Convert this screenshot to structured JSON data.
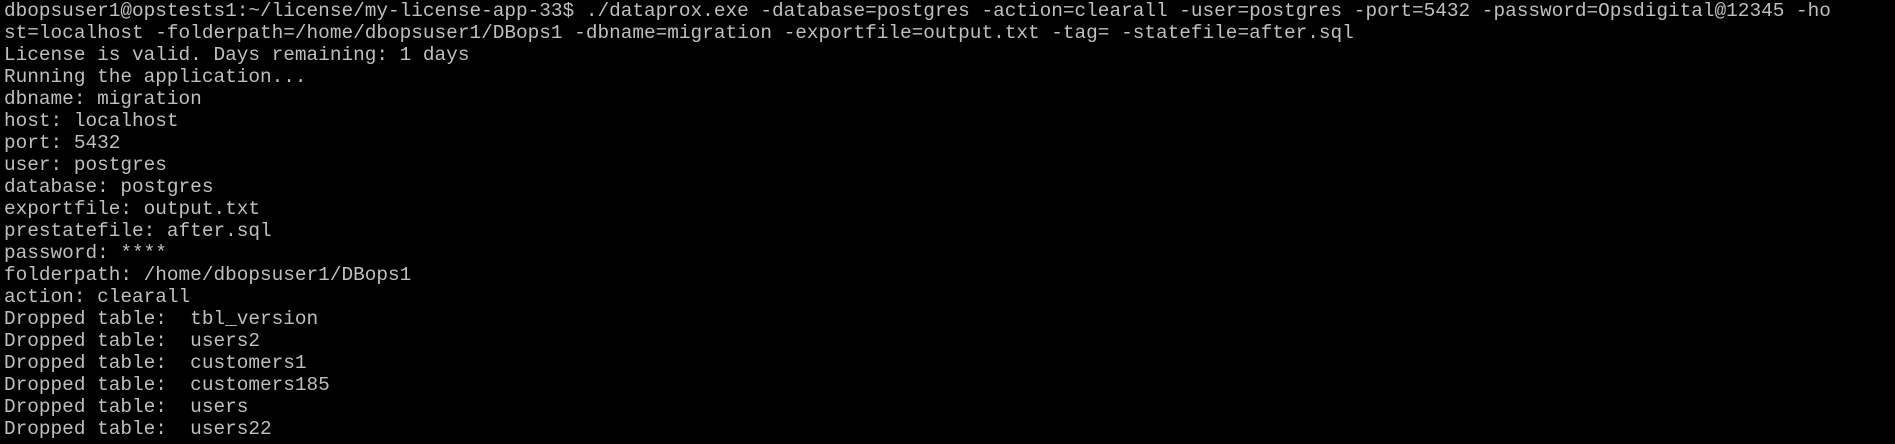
{
  "terminal": {
    "lines": [
      "dbopsuser1@opstests1:~/license/my-license-app-33$ ./dataprox.exe -database=postgres -action=clearall -user=postgres -port=5432 -password=Opsdigital@12345 -ho",
      "st=localhost -folderpath=/home/dbopsuser1/DBops1 -dbname=migration -exportfile=output.txt -tag= -statefile=after.sql",
      "License is valid. Days remaining: 1 days",
      "Running the application...",
      "dbname: migration",
      "host: localhost",
      "port: 5432",
      "user: postgres",
      "database: postgres",
      "exportfile: output.txt",
      "prestatefile: after.sql",
      "password: ****",
      "folderpath: /home/dbopsuser1/DBops1",
      "action: clearall",
      "Dropped table:  tbl_version",
      "Dropped table:  users2",
      "Dropped table:  customers1",
      "Dropped table:  customers185",
      "Dropped table:  users",
      "Dropped table:  users22"
    ],
    "colors": {
      "background": "#000000",
      "foreground": "#bfbfbf"
    }
  }
}
